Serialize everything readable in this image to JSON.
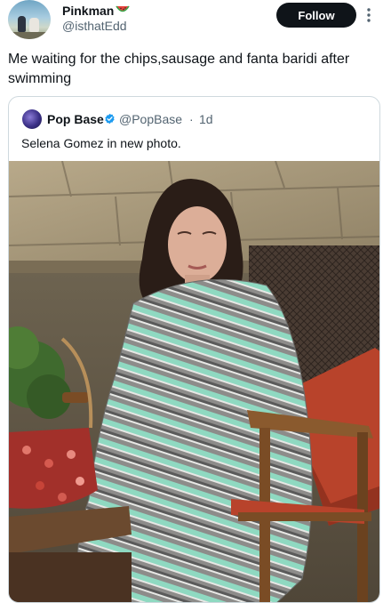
{
  "tweet": {
    "display_name": "Pinkman",
    "handle": "@isthatEdd",
    "follow_label": "Follow",
    "text": "Me waiting for the chips,sausage and fanta baridi after swimming",
    "name_emoji": "watermelon-icon"
  },
  "quote": {
    "display_name": "Pop Base",
    "handle": "@PopBase",
    "separator": "·",
    "time": "1d",
    "text": "Selena Gomez in new photo.",
    "verified": "verified-badge-icon"
  },
  "colors": {
    "text": "#0f1419",
    "muted": "#536471",
    "follow_bg": "#0f1419",
    "follow_text": "#ffffff",
    "verified": "#1d9bf0",
    "border": "#cfd9de"
  }
}
